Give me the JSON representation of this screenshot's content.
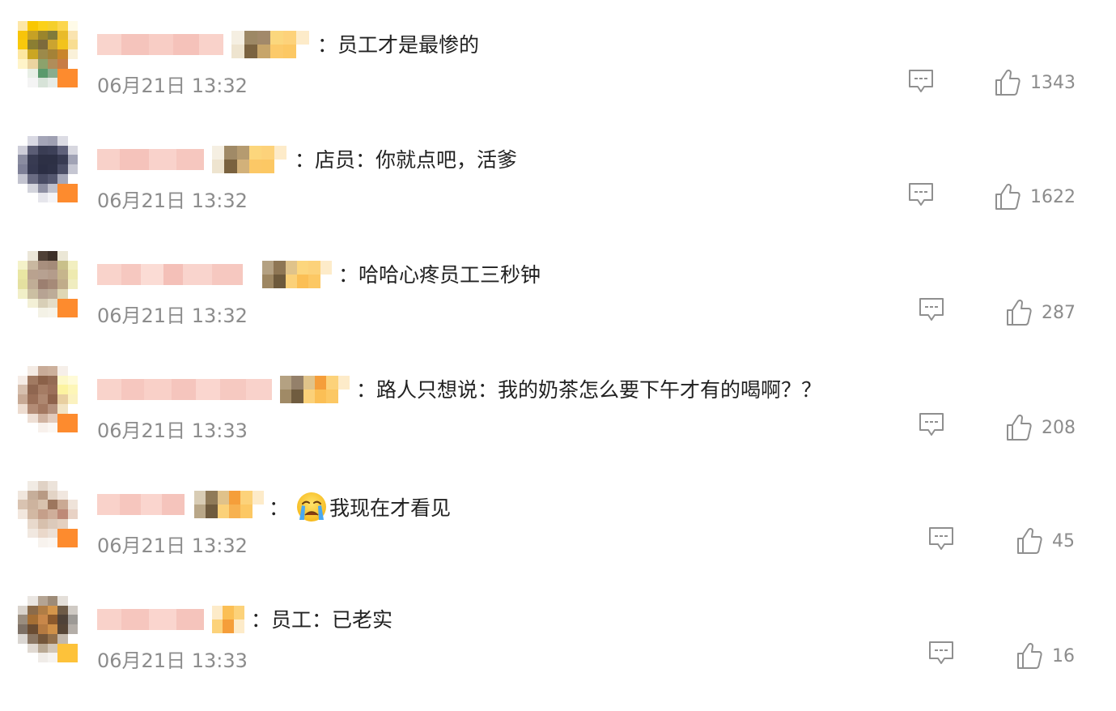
{
  "comments": [
    {
      "text": "员工才是最惨的",
      "time": "06月21日 13:32",
      "likes": "1343",
      "has_emoji": false
    },
    {
      "text": "店员：你就点吧，活爹",
      "time": "06月21日 13:32",
      "likes": "1622",
      "has_emoji": false
    },
    {
      "text": "哈哈心疼员工三秒钟",
      "time": "06月21日 13:32",
      "likes": "287",
      "has_emoji": false
    },
    {
      "text": "路人只想说：我的奶茶怎么要下午才有的喝啊？？",
      "time": "06月21日 13:33",
      "likes": "208",
      "has_emoji": false
    },
    {
      "text": "我现在才看见",
      "time": "06月21日 13:32",
      "likes": "45",
      "has_emoji": true,
      "emoji_name": "crying-face"
    },
    {
      "text": "员工：已老实",
      "time": "06月21日 13:33",
      "likes": "16",
      "has_emoji": false
    }
  ],
  "colors": {
    "text": "#222222",
    "meta": "#8c8c8c",
    "icon": "#8f8f8f",
    "name_blur": "#f6c9c2",
    "badge_orange": "#fda63a"
  },
  "icons": {
    "reply": "comment-bubble-icon",
    "like": "thumbs-up-icon"
  }
}
